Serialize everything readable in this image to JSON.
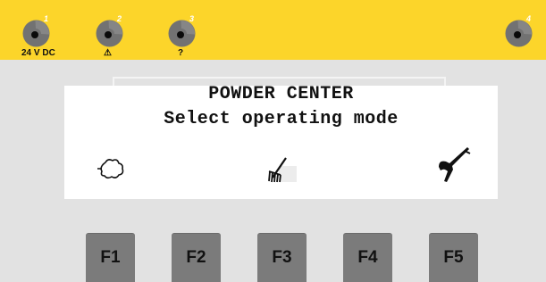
{
  "indicators": [
    {
      "number": "1",
      "label": "24 V DC"
    },
    {
      "number": "2",
      "label": "⚠"
    },
    {
      "number": "3",
      "label": "?"
    },
    {
      "number": "4",
      "label": ""
    }
  ],
  "display": {
    "line1": "POWDER CENTER",
    "line2": "Select operating mode",
    "icons": [
      "cloud-outline-icon",
      "powder-rake-icon",
      "gun-hook-icon"
    ]
  },
  "function_keys": [
    "F1",
    "F2",
    "F3",
    "F4",
    "F5"
  ],
  "colors": {
    "panel_yellow": "#fcd52a",
    "led_gray": "#727272",
    "key_gray": "#7b7b7b",
    "background": "#e2e2e2"
  }
}
